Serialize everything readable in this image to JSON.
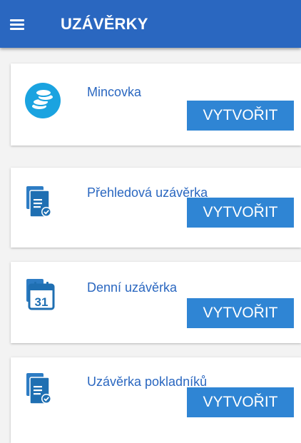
{
  "appbar": {
    "title": "UZÁVĚRKY",
    "menu_icon": "hamburger-menu-icon",
    "color": "#2a67c0"
  },
  "items": [
    {
      "label": "Mincovka",
      "button": "VYTVOŘIT",
      "icon": "coins-icon"
    },
    {
      "label": "Přehledová uzávěrka",
      "button": "VYTVOŘIT",
      "icon": "documents-check-icon"
    },
    {
      "label": "Denní uzávěrka",
      "button": "VYTVOŘIT",
      "icon": "calendar-31-icon",
      "calendar_day": "31"
    },
    {
      "label": "Uzávěrka pokladníků",
      "button": "VYTVOŘIT",
      "icon": "documents-check-icon"
    }
  ],
  "colors": {
    "accent": "#2f85d4",
    "coin_circle": "#1aa3e0",
    "icon_blue": "#1f6fb2"
  }
}
